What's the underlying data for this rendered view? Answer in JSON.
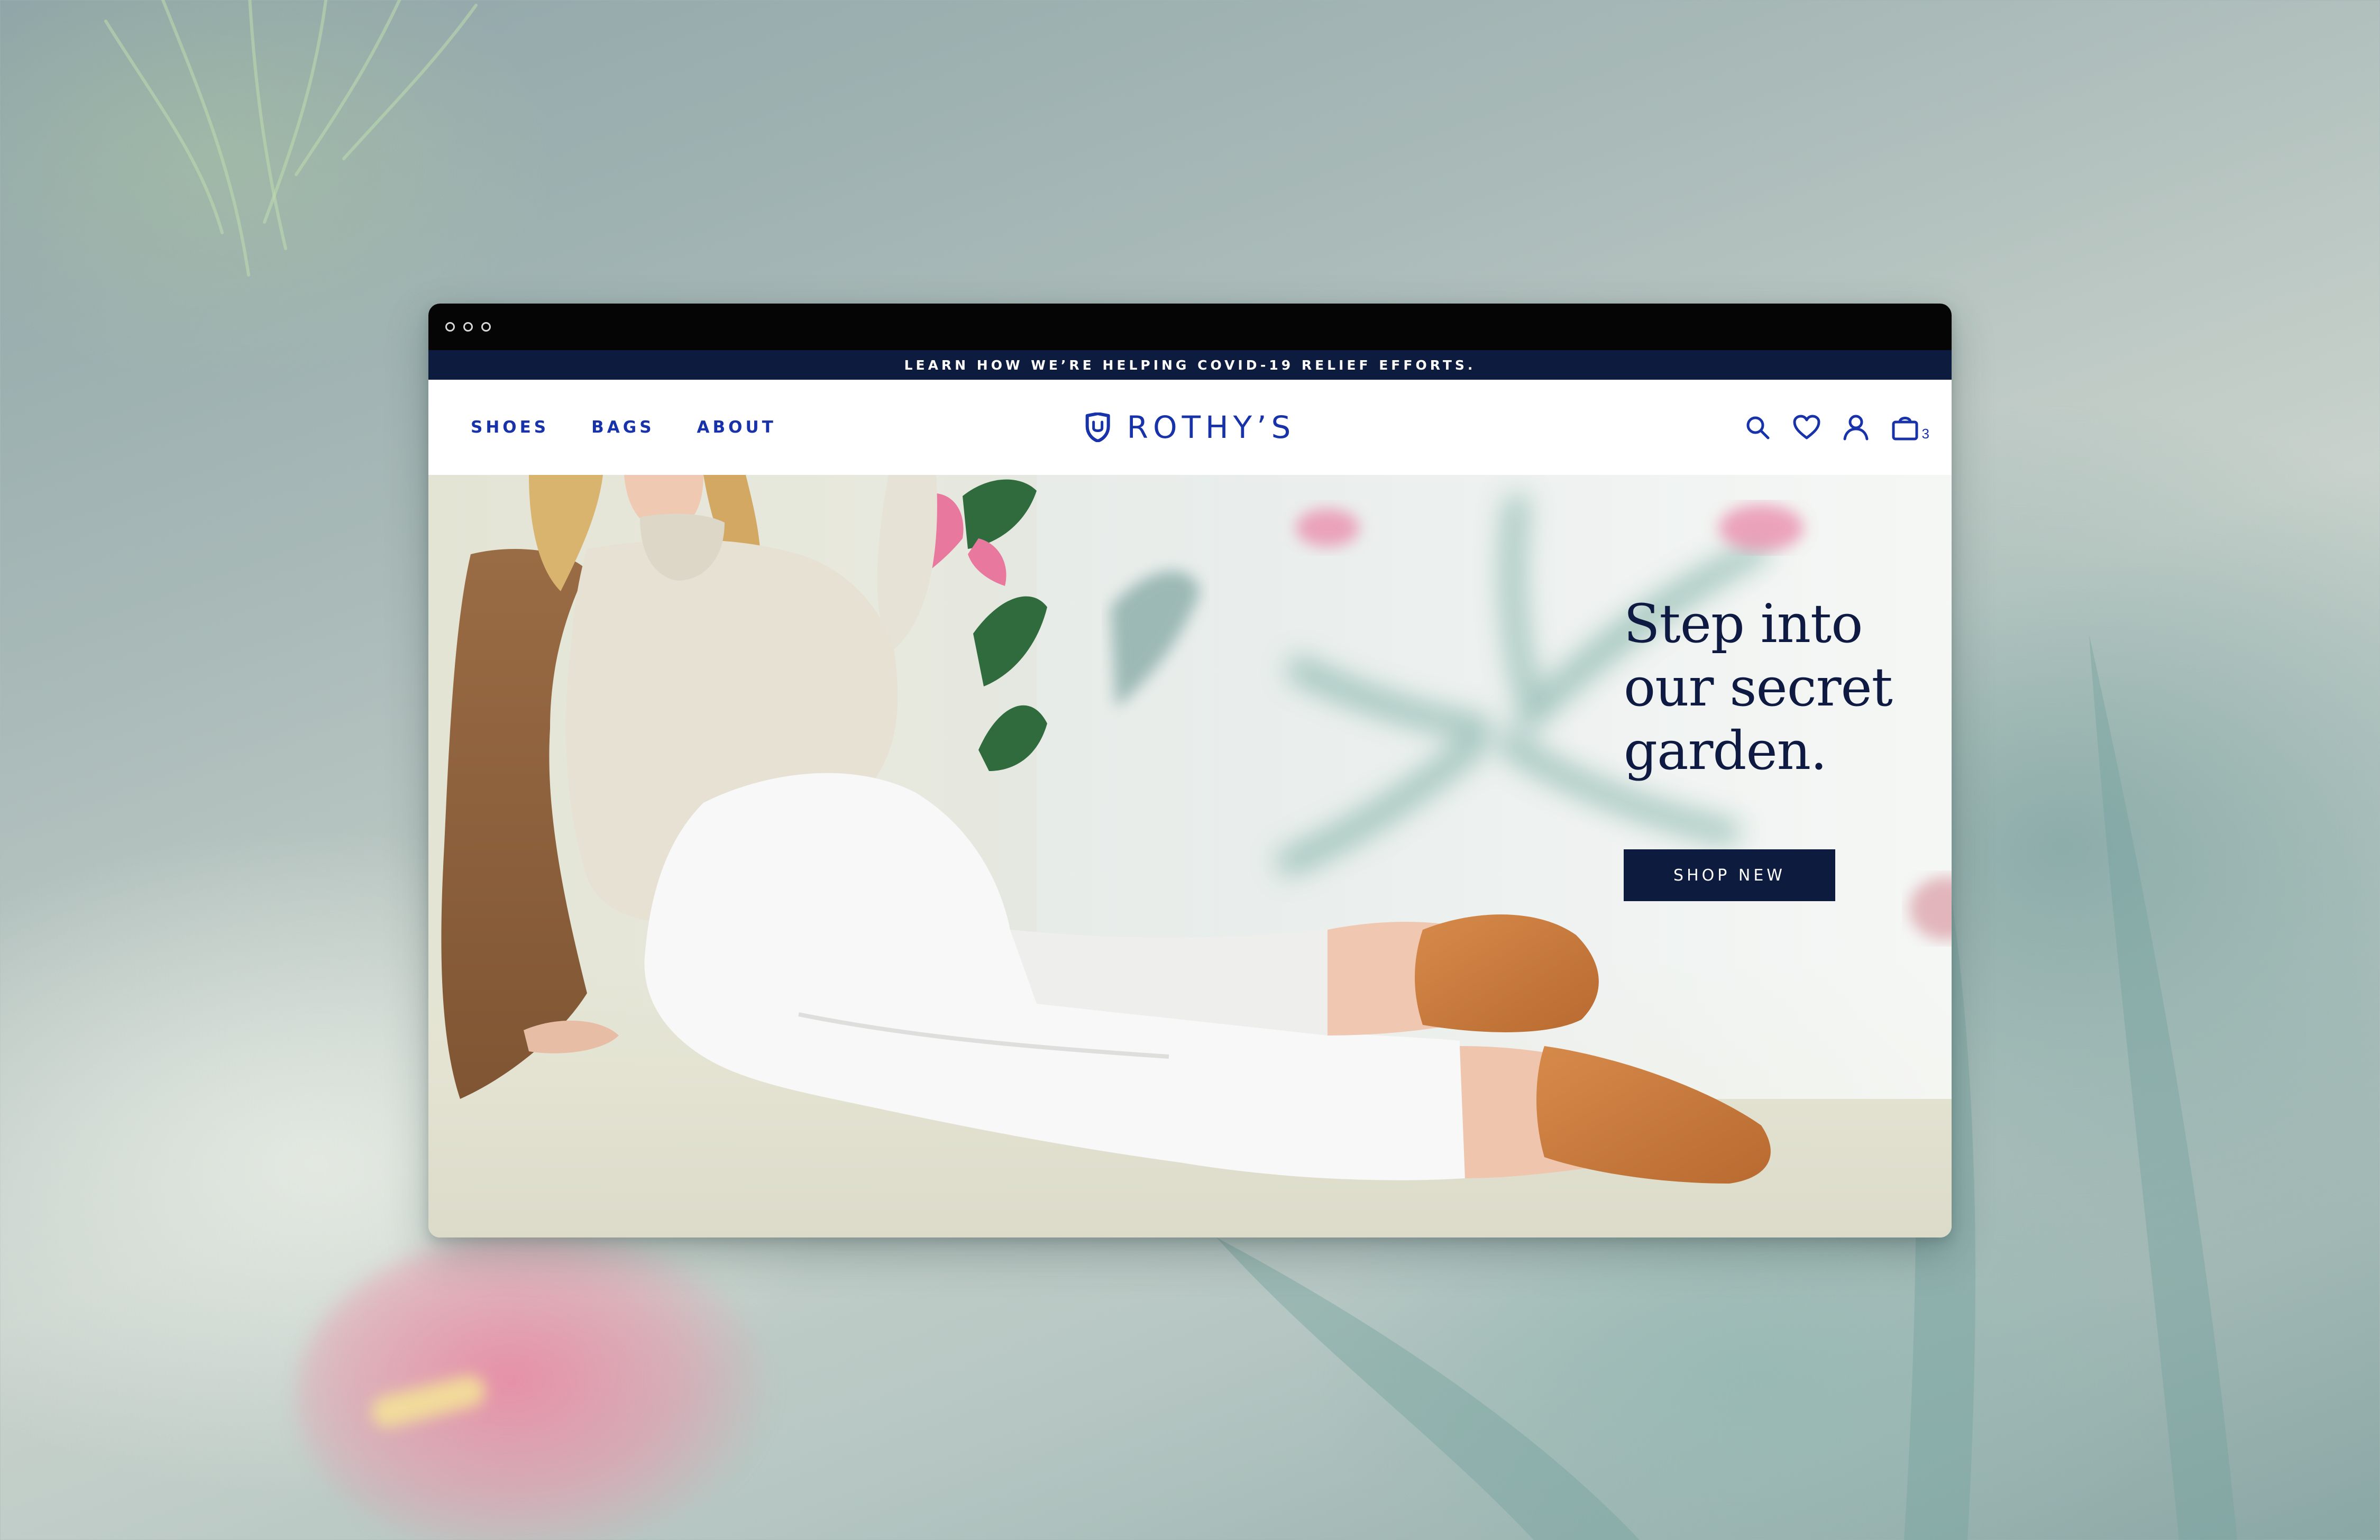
{
  "announcement": {
    "text": "LEARN HOW WE’RE HELPING COVID-19 RELIEF EFFORTS."
  },
  "nav": {
    "links": [
      "SHOES",
      "BAGS",
      "ABOUT"
    ],
    "logo_text": "ROTHY’S",
    "cart_count": "3",
    "icons": [
      "search-icon",
      "heart-icon",
      "account-icon",
      "shopping-bag-icon"
    ]
  },
  "hero": {
    "headline": "Step into our secret garden.",
    "cta_label": "SHOP NEW"
  },
  "colors": {
    "brand_blue": "#1832a9",
    "navy": "#0d1b3e",
    "headline": "#0e1a42",
    "titlebar": "#050506"
  }
}
